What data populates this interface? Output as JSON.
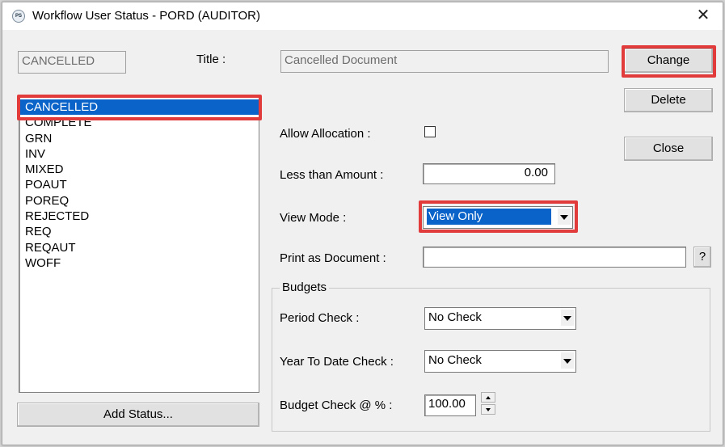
{
  "window": {
    "title": "Workflow User Status - PORD (AUDITOR)",
    "app_icon_text": "PS"
  },
  "status_code": "CANCELLED",
  "title_field": {
    "label": "Title :",
    "value": "Cancelled Document"
  },
  "buttons": {
    "change": "Change",
    "delete": "Delete",
    "close": "Close",
    "add_status": "Add Status...",
    "browse": "?"
  },
  "status_list": [
    "CANCELLED",
    "COMPLETE",
    "GRN",
    "INV",
    "MIXED",
    "POAUT",
    "POREQ",
    "REJECTED",
    "REQ",
    "REQAUT",
    "WOFF"
  ],
  "selected_status_index": 0,
  "allow_allocation": {
    "label": "Allow Allocation :",
    "checked": false
  },
  "less_than_amount": {
    "label": "Less than Amount :",
    "value": "0.00"
  },
  "view_mode": {
    "label": "View Mode :",
    "value": "View Only"
  },
  "print_as_document": {
    "label": "Print as Document :",
    "value": ""
  },
  "budgets": {
    "group_label": "Budgets",
    "period_check": {
      "label": "Period Check :",
      "value": "No Check"
    },
    "ytd_check": {
      "label": "Year To Date Check :",
      "value": "No Check"
    },
    "budget_check_pct": {
      "label": "Budget Check @ % :",
      "value": "100.00"
    }
  },
  "colors": {
    "highlight": "#e23b3b",
    "selection": "#0a63c9",
    "dialog_bg": "#f0f0f0"
  }
}
